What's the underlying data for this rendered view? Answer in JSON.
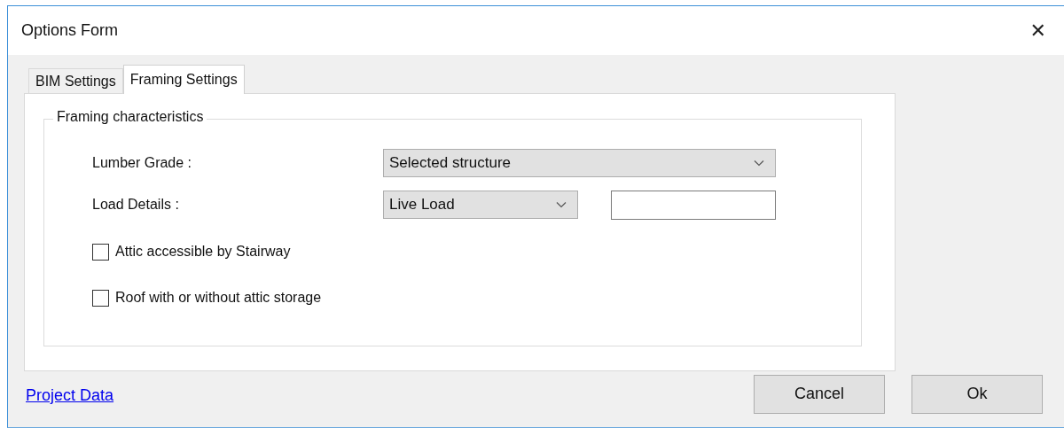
{
  "window": {
    "title": "Options Form",
    "close": "✕"
  },
  "tabs": [
    {
      "label": "BIM Settings",
      "selected": false
    },
    {
      "label": "Framing Settings",
      "selected": true
    }
  ],
  "group": {
    "title": "Framing characteristics",
    "rows": [
      {
        "kind": "dropdown",
        "label": "Lumber Grade :",
        "value": "Selected structure"
      },
      {
        "kind": "dropdown-text",
        "label": "Load Details :",
        "value": "Live Load",
        "text": ""
      }
    ],
    "checkboxes": [
      {
        "label": "Attic accessible by Stairway",
        "checked": false
      },
      {
        "label": "Roof with or without attic storage",
        "checked": false
      }
    ]
  },
  "link": "Project Data",
  "buttons": [
    "Cancel",
    "Ok"
  ]
}
